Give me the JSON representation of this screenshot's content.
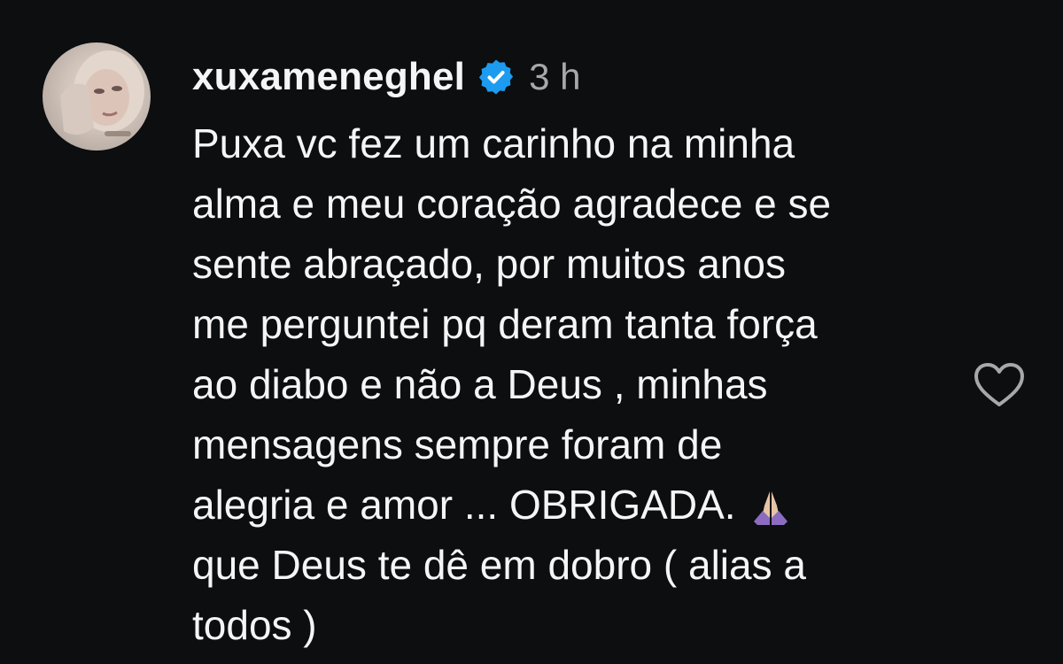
{
  "comment": {
    "username": "xuxameneghel",
    "time": "3 h",
    "text_lines": [
      "Puxa vc fez um carinho na minha",
      "alma e meu coração agradece e se",
      "sente abraçado, por muitos anos",
      "me perguntei pq deram tanta força",
      "ao diabo e não a Deus , minhas",
      "mensagens sempre foram de",
      "alegria e amor ... OBRIGADA.",
      "que Deus te dê em dobro ( alias a",
      "todos )"
    ]
  },
  "icons": {
    "verified": "verified-badge-icon",
    "prayer": "folded-hands-emoji",
    "like": "heart-outline-icon"
  },
  "colors": {
    "background": "#0c0e10",
    "text": "#f5f5f5",
    "muted": "#a8a8a8",
    "verified": "#1d9bf0",
    "emoji": "#8b6cc0"
  }
}
